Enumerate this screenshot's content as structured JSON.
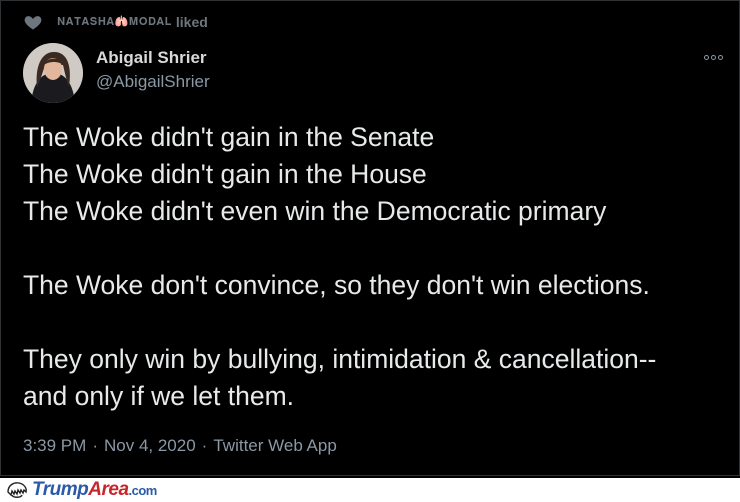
{
  "social_context": {
    "liker": "𝐍𝐀𝐓𝐀𝐒𝐇𝐀🫁𝐌𝐎𝐃𝐀𝐋",
    "verb": "liked"
  },
  "author": {
    "name": "Abigail Shrier",
    "handle": "@AbigailShrier"
  },
  "tweet": {
    "lines": [
      "The Woke didn't gain in the Senate",
      "The Woke didn't gain in the House",
      "The Woke didn't even win the Democratic primary",
      "",
      "The Woke don't convince, so they don't win elections.",
      "",
      "They only win by bullying, intimidation & cancellation--",
      "and only if we let them."
    ],
    "time": "3:39 PM",
    "date": "Nov 4, 2020",
    "source": "Twitter Web App",
    "separator": "·"
  },
  "watermark": {
    "trump": "Trump",
    "area": "Area",
    "com": ".com"
  },
  "colors": {
    "background": "#000000",
    "muted": "#8b98a5",
    "text": "#e7e9ea"
  },
  "icons": {
    "like": "heart-icon",
    "more": "more-options-icon"
  }
}
